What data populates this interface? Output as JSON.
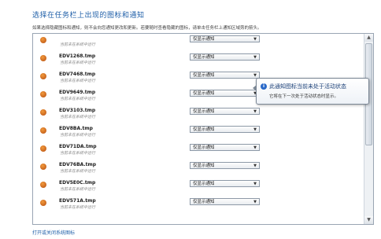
{
  "title": "选择在任务栏上出现的图标和通知",
  "description": "如果选择隐藏图标和通知，则不会向您通知更改和更新。若要随时查看隐藏的图标，请单击任务栏上通知区域旁的箭头。",
  "rows": [
    {
      "name": "",
      "sub": "当前未在系统中运行",
      "behavior": "仅显示通知"
    },
    {
      "name": "EDV1268.tmp",
      "sub": "当前未在系统中运行",
      "behavior": "仅显示通知"
    },
    {
      "name": "EDV7468.tmp",
      "sub": "当前未在系统中运行",
      "behavior": "仅显示通知"
    },
    {
      "name": "EDV9649.tmp",
      "sub": "当前未在系统中运行",
      "behavior": "仅显示通知"
    },
    {
      "name": "EDV3103.tmp",
      "sub": "当前未在系统中运行",
      "behavior": "仅显示通知"
    },
    {
      "name": "EDV8BA.tmp",
      "sub": "当前未在系统中运行",
      "behavior": "仅显示通知"
    },
    {
      "name": "EDV71DA.tmp",
      "sub": "当前未在系统中运行",
      "behavior": "仅显示通知"
    },
    {
      "name": "EDV76BA.tmp",
      "sub": "当前未在系统中运行",
      "behavior": "仅显示通知"
    },
    {
      "name": "EDV5E0C.tmp",
      "sub": "当前未在系统中运行",
      "behavior": "仅显示通知"
    },
    {
      "name": "EDV571A.tmp",
      "sub": "当前未在系统中运行",
      "behavior": "仅显示通知"
    }
  ],
  "tooltip": {
    "title": "此通知图标当前未处于活动状态",
    "body": "它将在下一次处于活动状态时显示。"
  },
  "bottom_link": "打开或关闭系统图标"
}
